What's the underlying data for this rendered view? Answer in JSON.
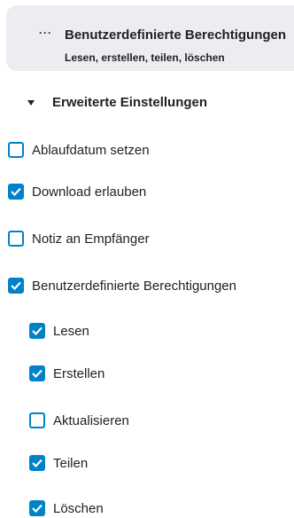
{
  "permission_card": {
    "dots": "···",
    "title": "Benutzerdefinierte Berechtigungen",
    "subtitle": "Lesen, erstellen, teilen, löschen"
  },
  "advanced": {
    "label": "Erweiterte Einstellungen",
    "expanded": true
  },
  "options": [
    {
      "label": "Ablaufdatum setzen",
      "checked": false
    },
    {
      "label": "Download erlauben",
      "checked": true
    },
    {
      "label": "Notiz an Empfänger",
      "checked": false
    },
    {
      "label": "Benutzerdefinierte Berechtigungen",
      "checked": true
    }
  ],
  "permissions": [
    {
      "label": "Lesen",
      "checked": true
    },
    {
      "label": "Erstellen",
      "checked": true
    },
    {
      "label": "Aktualisieren",
      "checked": false
    },
    {
      "label": "Teilen",
      "checked": true
    },
    {
      "label": "Löschen",
      "checked": true
    }
  ],
  "colors": {
    "accent": "#0082c9",
    "card_background": "#ebedf0",
    "text": "#222222"
  }
}
